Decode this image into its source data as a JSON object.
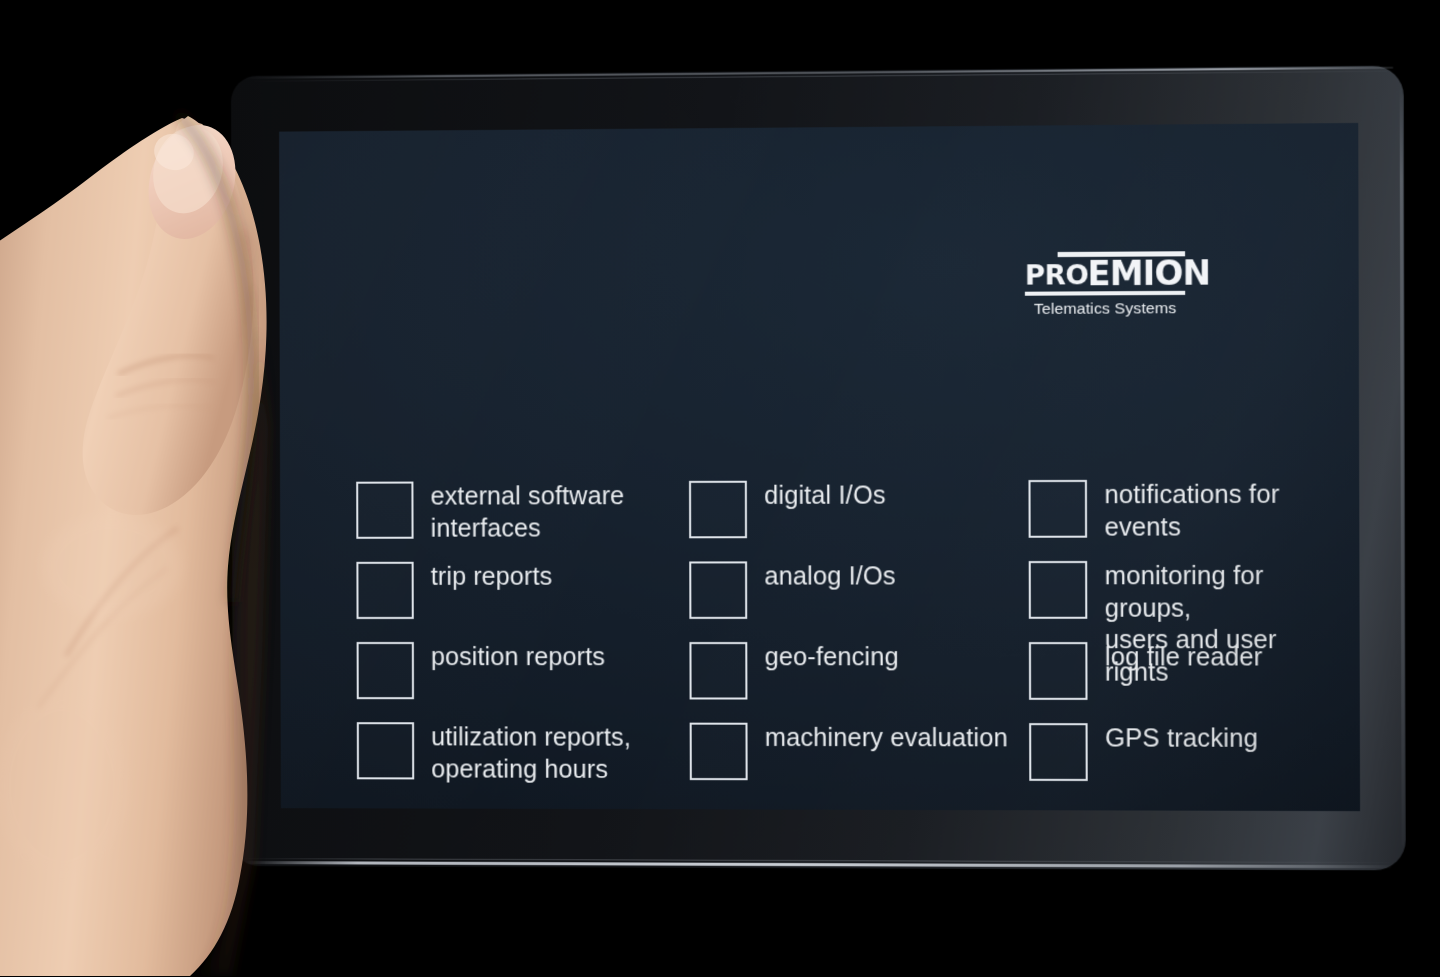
{
  "device": {
    "name": "tablet",
    "screen_background": "#17222f",
    "bezel_color": "#15181c"
  },
  "screen": {
    "logo": {
      "name": "proemion-logo",
      "word_part1": "PRO",
      "word_part2": "EMION",
      "full_text": "PROEMION",
      "tagline": "Telematics Systems",
      "color": "#f2f4f7"
    },
    "feature_checklist": {
      "name": "feature-checklist",
      "checkbox_color": "#dfe4ea",
      "label_color": "#e9ecef",
      "columns": [
        {
          "name": "column-1",
          "items": [
            {
              "label": "external software\ninterfaces",
              "checked": false
            },
            {
              "label": "trip reports",
              "checked": false
            },
            {
              "label": "position reports",
              "checked": false
            },
            {
              "label": "utilization reports,\noperating hours",
              "checked": false
            }
          ]
        },
        {
          "name": "column-2",
          "items": [
            {
              "label": "digital I/Os",
              "checked": false
            },
            {
              "label": "analog I/Os",
              "checked": false
            },
            {
              "label": "geo-fencing",
              "checked": false
            },
            {
              "label": "machinery evaluation",
              "checked": false
            }
          ]
        },
        {
          "name": "column-3",
          "items": [
            {
              "label": "notifications for\nevents",
              "checked": false
            },
            {
              "label": "monitoring for groups,\nusers and user rights",
              "checked": false
            },
            {
              "label": "log file reader",
              "checked": false
            },
            {
              "label": "GPS tracking",
              "checked": false
            }
          ]
        }
      ]
    }
  },
  "hand": {
    "name": "hand-holding-tablet",
    "description": "left hand gripping the left edge of the tablet"
  }
}
